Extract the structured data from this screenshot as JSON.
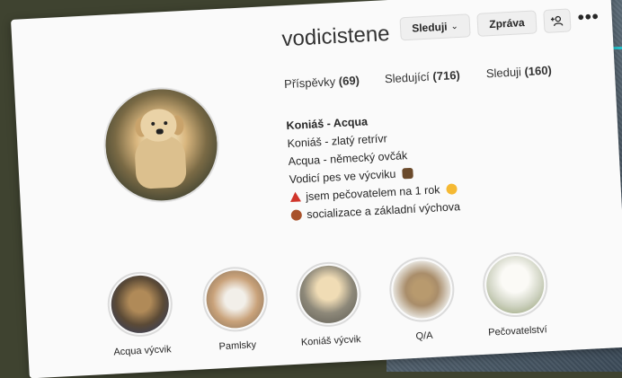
{
  "profile": {
    "username": "vodicistene",
    "buttons": {
      "follow": "Sleduji",
      "message": "Zpráva",
      "add_icon": "person-add-icon",
      "more_icon": "more-icon"
    },
    "stats": {
      "posts_label": "Příspěvky",
      "posts_count": "(69)",
      "followers_label": "Sledující",
      "followers_count": "(716)",
      "following_label": "Sleduji",
      "following_count": "(160)"
    },
    "bio": {
      "name": "Koniáš - Acqua",
      "line1": "Koniáš - zlatý retrívr",
      "line2": "Acqua - německý ovčák",
      "line3": "Vodicí pes ve výcviku",
      "line4": "jsem pečovatelem na 1 rok",
      "line5": "socializace a základní výchova"
    }
  },
  "highlights": [
    {
      "label": "Acqua výcvik",
      "color": "#5b4a36"
    },
    {
      "label": "Pamlsky",
      "color": "#c9a27a"
    },
    {
      "label": "Koniáš výcvik",
      "color": "#8d8879"
    },
    {
      "label": "Q/A",
      "color": "#a98d6a"
    },
    {
      "label": "Pečovatelství",
      "color": "#cfd3c2"
    }
  ],
  "colors": {
    "accent_line": "#26c6d0",
    "background_left": "#3f4330"
  }
}
